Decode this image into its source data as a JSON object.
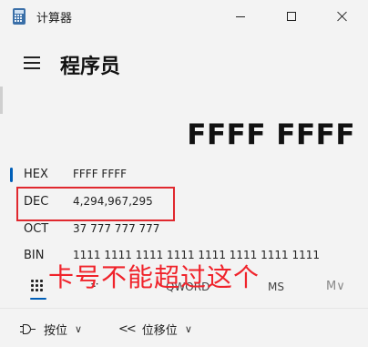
{
  "window": {
    "title": "计算器"
  },
  "header": {
    "mode_title": "程序员"
  },
  "display": {
    "value": "FFFF FFFF"
  },
  "radix": [
    {
      "name": "HEX",
      "value": "FFFF FFFF"
    },
    {
      "name": "DEC",
      "value": "4,294,967,295"
    },
    {
      "name": "OCT",
      "value": "37 777 777 777"
    },
    {
      "name": "BIN",
      "value": "1111 1111 1111 1111 1111 1111 1111 1111"
    }
  ],
  "toolbar": {
    "bitflip_label": "⁘",
    "word_size_label": "QWORD",
    "ms_label": "MS",
    "m_label": "M∨"
  },
  "annotation": {
    "text": "卡号不能超过这个"
  },
  "bottom": {
    "bitwise_label": "按位",
    "bitshift_label": "位移位",
    "chevron": "∨"
  },
  "colors": {
    "annotation_red": "#e0282e",
    "accent": "#005fb8"
  }
}
